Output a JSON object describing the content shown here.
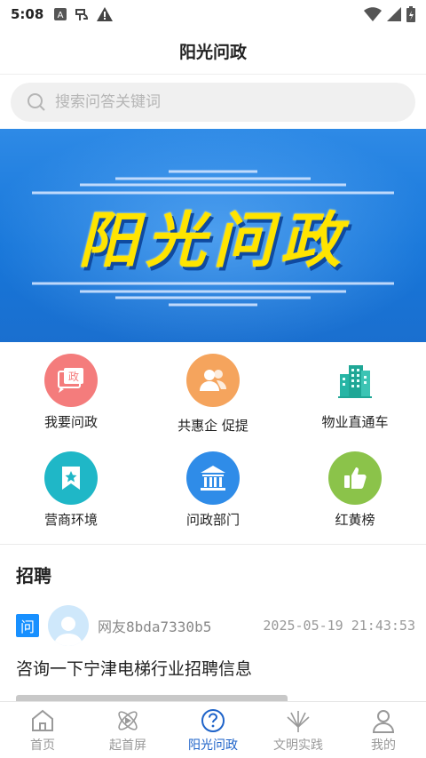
{
  "status": {
    "time": "5:08"
  },
  "header": {
    "title": "阳光问政"
  },
  "search": {
    "placeholder": "搜索问答关键词"
  },
  "banner": {
    "title": "阳光问政"
  },
  "grid": [
    {
      "label": "我要问政",
      "icon": "petition-icon",
      "color": "#f47c7c"
    },
    {
      "label": "共惠企  促提",
      "icon": "people-icon",
      "color": "#f5a45d"
    },
    {
      "label": "物业直通车",
      "icon": "building-icon",
      "color": "#26b5a5"
    },
    {
      "label": "营商环境",
      "icon": "star-bookmark-icon",
      "color": "#1fb7c7"
    },
    {
      "label": "问政部门",
      "icon": "bank-icon",
      "color": "#2f8ce8"
    },
    {
      "label": "红黄榜",
      "icon": "thumbs-up-icon",
      "color": "#8bc34a"
    }
  ],
  "section": {
    "title": "招聘"
  },
  "post": {
    "badge": "问",
    "user": "网友8bda7330b5",
    "time": "2025-05-19 21:43:53",
    "question": "咨询一下宁津电梯行业招聘信息"
  },
  "tabs": [
    {
      "label": "首页",
      "icon": "home-icon"
    },
    {
      "label": "起首屏",
      "icon": "atom-play-icon"
    },
    {
      "label": "阳光问政",
      "icon": "question-circle-icon",
      "active": true
    },
    {
      "label": "文明实践",
      "icon": "fan-icon"
    },
    {
      "label": "我的",
      "icon": "user-icon"
    }
  ],
  "colors": {
    "accent": "#1e63c9",
    "badge": "#1890ff",
    "banner": "#1776d9",
    "banner_text": "#ffe400"
  }
}
